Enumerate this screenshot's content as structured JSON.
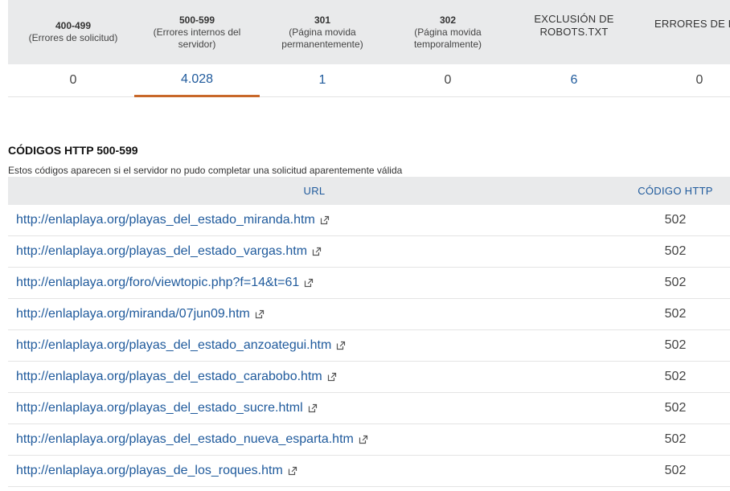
{
  "summary": {
    "columns": [
      {
        "code": "400-499",
        "sub": "(Errores de solicitud)",
        "value": "0",
        "link": false,
        "active": false
      },
      {
        "code": "500-599",
        "sub": "(Errores internos del\nservidor)",
        "value": "4.028",
        "link": true,
        "active": true
      },
      {
        "code": "301",
        "sub": "(Página movida\npermanentemente)",
        "value": "1",
        "link": true,
        "active": false
      },
      {
        "code": "302",
        "sub": "(Página movida\ntemporalmente)",
        "value": "0",
        "link": false,
        "active": false
      },
      {
        "code": "EXCLUSIÓN DE\nROBOTS.TXT",
        "sub": "",
        "value": "6",
        "link": true,
        "active": false
      },
      {
        "code": "ERRORES DE D",
        "sub": "",
        "value": "0",
        "link": false,
        "active": false
      }
    ]
  },
  "section": {
    "title": "CÓDIGOS HTTP 500-599",
    "description": "Estos códigos aparecen si el servidor no pudo completar una solicitud aparentemente válida"
  },
  "table": {
    "headers": {
      "url": "URL",
      "code": "CÓDIGO HTTP"
    },
    "rows": [
      {
        "url": "http://enlaplaya.org/playas_del_estado_miranda.htm",
        "code": "502"
      },
      {
        "url": "http://enlaplaya.org/playas_del_estado_vargas.htm",
        "code": "502"
      },
      {
        "url": "http://enlaplaya.org/foro/viewtopic.php?f=14&t=61",
        "code": "502"
      },
      {
        "url": "http://enlaplaya.org/miranda/07jun09.htm",
        "code": "502"
      },
      {
        "url": "http://enlaplaya.org/playas_del_estado_anzoategui.htm",
        "code": "502"
      },
      {
        "url": "http://enlaplaya.org/playas_del_estado_carabobo.htm",
        "code": "502"
      },
      {
        "url": "http://enlaplaya.org/playas_del_estado_sucre.html",
        "code": "502"
      },
      {
        "url": "http://enlaplaya.org/playas_del_estado_nueva_esparta.htm",
        "code": "502"
      },
      {
        "url": "http://enlaplaya.org/playas_de_los_roques.htm",
        "code": "502"
      }
    ]
  },
  "colors": {
    "link": "#1f5a9c",
    "active_underline": "#c8682a",
    "header_bg": "#e9eaeb"
  },
  "icons": {
    "external": "external-link-icon"
  }
}
